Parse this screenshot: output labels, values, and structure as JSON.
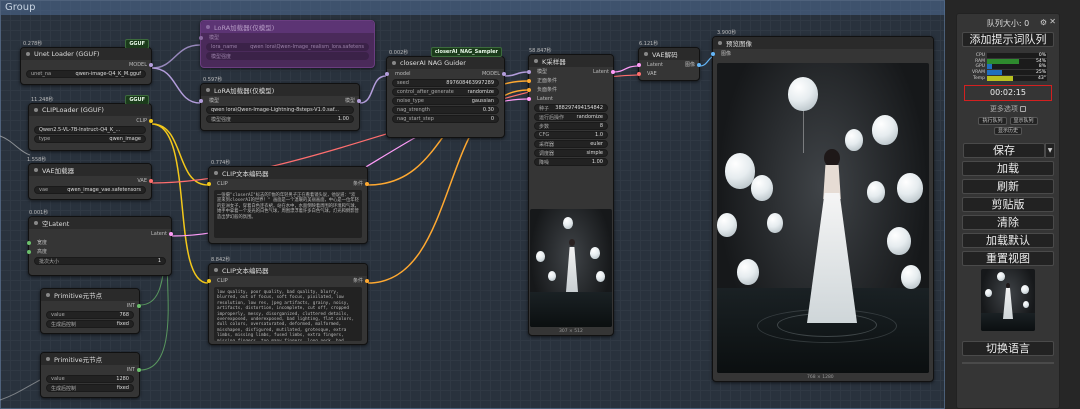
{
  "group": {
    "title": "Group"
  },
  "nodes": {
    "unet": {
      "time": "0.278秒",
      "badge": "GGUF",
      "title": "Unet Loader (GGUF)",
      "output": "MODEL",
      "widget_label": "unet_na",
      "widget_value": "qwen-image-Q4_K_M.gguf"
    },
    "clip_loader": {
      "time": "11.248秒",
      "badge": "GGUF",
      "title": "CLIPLoader (GGUF)",
      "output": "CLIP",
      "w1_value": "Qwen2.5-VL-7B-Instruct-Q4_K_...",
      "w2_label": "type",
      "w2_value": "qwen_image"
    },
    "vae_loader": {
      "time": "1.558秒",
      "title": "VAE加载器",
      "output": "VAE",
      "widget_label": "vae",
      "widget_value": "qwen_image_vae.safetensors"
    },
    "latent": {
      "time": "0.001秒",
      "title": "空Latent",
      "output": "Latent",
      "w1": "宽度",
      "w2": "高度",
      "w3_label": "批次大小",
      "w3_value": "1"
    },
    "prim1": {
      "title": "Primitive元节点",
      "output": "INT",
      "v_label": "value",
      "v_value": "768",
      "c_label": "生成后控制",
      "c_value": "fixed"
    },
    "prim2": {
      "title": "Primitive元节点",
      "output": "INT",
      "v_label": "value",
      "v_value": "1280",
      "c_label": "生成后控制",
      "c_value": "fixed"
    },
    "lora_bypass": {
      "title": "LoRA加载器(仅模型)",
      "in": "模型",
      "widget_label": "lora_name",
      "widget_value": "qwen lora\\Qwen-Image_realism_lora.safetens",
      "w2": "模型强度"
    },
    "lora": {
      "time": "0.597秒",
      "title": "LoRA加载器(仅模型)",
      "in": "模型",
      "out": "模型",
      "widget_value": "qwen lora\\Qwen-Image-Lightning-8steps-V1.0.saf...",
      "w2_label": "模型强度",
      "w2_value": "1.00"
    },
    "nag": {
      "time": "0.002秒",
      "badge": "closerAI_NAG_Sampler",
      "title": "closerAI NAG Guider",
      "in_model": "model",
      "out_model": "MODEL",
      "rows": [
        {
          "label": "seed",
          "value": "897608463997289"
        },
        {
          "label": "control_after_generate",
          "value": "randomize"
        },
        {
          "label": "noise_type",
          "value": "gaussian"
        },
        {
          "label": "nag_strength",
          "value": "0.30"
        },
        {
          "label": "nag_start_step",
          "value": "0"
        }
      ]
    },
    "clip_text1": {
      "time": "0.774秒",
      "title": "CLIP文本编码器",
      "in": "CLIP",
      "out": "条件",
      "text": "一张摄\"closerAI\"标志的T恤的年轻男子正在看着镜头说，他说道：\"欢迎来到closerAI的世界！\"\n画面是一个温暖的美丽画面，中心是一位年轻的亚洲女子，穿着白色连衣裙，站在水中，水面倒映着周围的环境和气球，她手中拿着一个发光的白色气球，周围漂浮着许多白色气球，灯光和倒影营造出梦幻般的氛围。"
    },
    "clip_text2": {
      "time": "8.842秒",
      "title": "CLIP文本编码器",
      "in": "CLIP",
      "out": "条件",
      "text": "low quality, poor quality, bad quality, blurry, blurred, out of focus, soft focus, pixilated, low resolution, low res, jpeg artifacts, grainy, noisy, artifacts, distortion, incomplete, cut off, cropped improperly, messy, disorganized, cluttered details, overexposed, underexposed, bad lighting, flat colors, dull colors, oversaturated, deformed, malformed, misshapen, disfigured, mutilated, grotesque, extra limbs, missing limbs, fused limbs, extra fingers, missing fingers, too many fingers, long neck, bad anatomy, bad proportions"
    },
    "ksampler": {
      "time": "58.847秒",
      "title": "K采样器",
      "inputs": [
        "模型",
        "正面条件",
        "负面条件",
        "Latent"
      ],
      "output": "Latent",
      "rows": [
        {
          "label": "种子",
          "value": "388297494154842"
        },
        {
          "label": "运行后操作",
          "value": "randomize"
        },
        {
          "label": "步数",
          "value": "8"
        },
        {
          "label": "CFG",
          "value": "1.0"
        },
        {
          "label": "采样器",
          "value": "euler"
        },
        {
          "label": "调度器",
          "value": "simple"
        },
        {
          "label": "降噪",
          "value": "1.00"
        }
      ],
      "img_size": "307 × 512"
    },
    "vae_decode": {
      "time": "6.121秒",
      "title": "VAE解码",
      "in1": "Latent",
      "in2": "VAE",
      "out": "图像"
    },
    "preview": {
      "time": "3.900秒",
      "title": "预览图像",
      "in": "图像",
      "img_size": "768 × 1280"
    }
  },
  "panel": {
    "queue_label": "队列大小: 0",
    "queue_btn": "添加提示词队列",
    "stats": [
      {
        "label": "CPU",
        "pct": "0%",
        "value": 0,
        "color": "#2e8b2e"
      },
      {
        "label": "RAM",
        "pct": "54%",
        "value": 54,
        "color": "#2e8b2e"
      },
      {
        "label": "GPU",
        "pct": "8%",
        "value": 8,
        "color": "#1f6fbf"
      },
      {
        "label": "VRAM",
        "pct": "25%",
        "value": 25,
        "color": "#1f6fbf"
      },
      {
        "label": "Temp",
        "pct": "43°",
        "value": 43,
        "color": "#b8c020"
      }
    ],
    "timer": "00:02:15",
    "more_options": "更多选项",
    "small_btns": [
      "执行队列",
      "显示队列",
      "显示历史"
    ],
    "save": "保存",
    "load": "加载",
    "refresh": "刷新",
    "clipspace": "剪贴版",
    "clear": "清除",
    "load_default": "加载默认",
    "reset_view": "重置视图",
    "switch_lang": "切换语言"
  }
}
